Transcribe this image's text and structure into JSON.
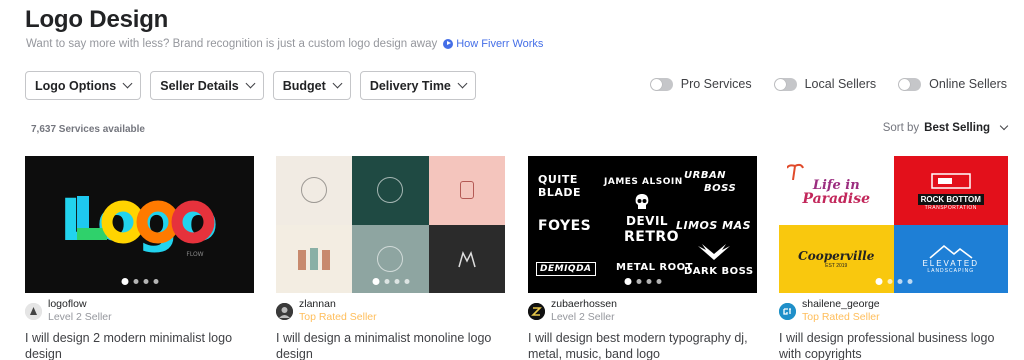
{
  "header": {
    "title": "Logo Design",
    "subtitle": "Want to say more with less? Brand recognition is just a custom logo design away",
    "how_link": "How Fiverr Works"
  },
  "filters": [
    "Logo Options",
    "Seller Details",
    "Budget",
    "Delivery Time"
  ],
  "toggles": [
    "Pro Services",
    "Local Sellers",
    "Online Sellers"
  ],
  "results": {
    "count": "7,637 Services available",
    "sort_label": "Sort by",
    "sort_value": "Best Selling"
  },
  "gigs": [
    {
      "seller": "logoflow",
      "level": "Level 2 Seller",
      "title": "I will design 2 modern minimalist logo design",
      "thumb_text": [
        "Logo",
        "FLOW"
      ]
    },
    {
      "seller": "zlannan",
      "level": "Top Rated Seller",
      "title": "I will design a minimalist monoline logo design"
    },
    {
      "seller": "zubaerhossen",
      "level": "Level 2 Seller",
      "title": "I will design best modern typography dj, metal, music, band logo",
      "thumb_text": [
        "QUITE",
        "BLADE",
        "JAMES ALSOIN",
        "URBAN",
        "BOSS",
        "FOYES",
        "DEVIL",
        "RETRO",
        "LIMOS MAS",
        "DEMIQDA",
        "METAL ROOT",
        "DARK BOSS"
      ]
    },
    {
      "seller": "shailene_george",
      "level": "Top Rated Seller",
      "title": "I will design professional business logo with copyrights",
      "thumb_text": [
        "Life in",
        "Paradise",
        "ROCK BOTTOM",
        "TRANSPORTATION",
        "Cooperville",
        "EST 2019",
        "ELEVATED",
        "LANDSCAPING"
      ]
    }
  ],
  "colors": {
    "accent_link": "#446ee7",
    "top_rated": "#ffbe5b",
    "muted_text": "#95979d"
  }
}
